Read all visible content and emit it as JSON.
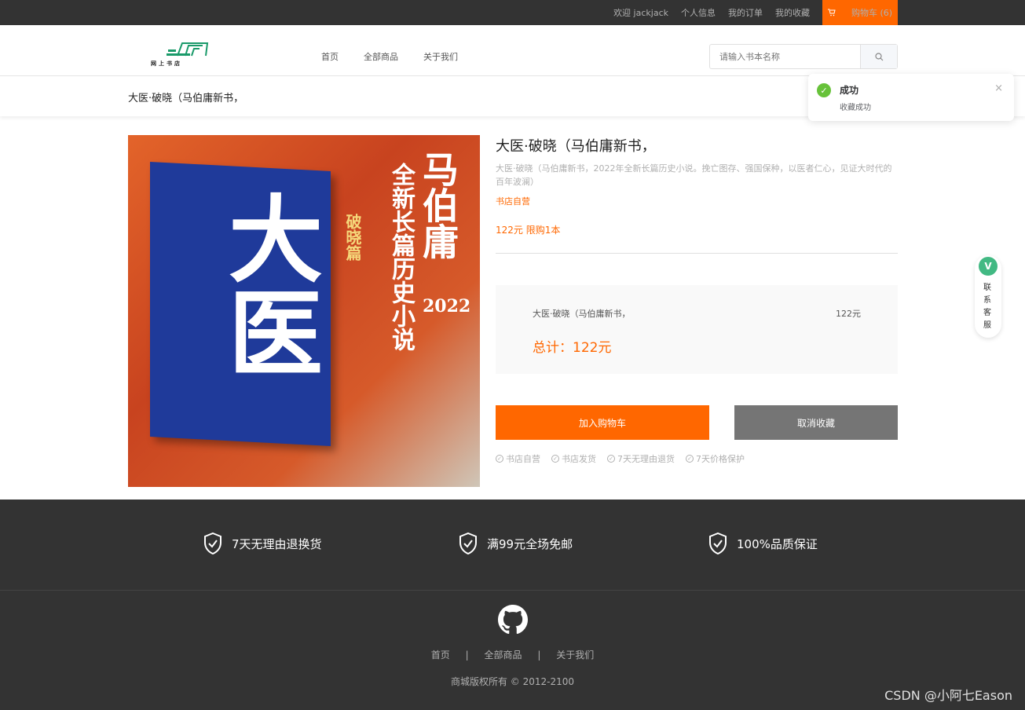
{
  "topbar": {
    "welcome": "欢迎 jackjack",
    "profile": "个人信息",
    "orders": "我的订单",
    "favorites": "我的收藏",
    "cart": "购物车 (6)"
  },
  "header": {
    "logo_text": "网上书店",
    "nav": [
      "首页",
      "全部商品",
      "关于我们"
    ],
    "search_placeholder": "请输入书本名称"
  },
  "breadcrumb_title": "大医·破晓（马伯庸新书，",
  "toast": {
    "title": "成功",
    "message": "收藏成功",
    "close": "×"
  },
  "cover": {
    "big_chars": "大医",
    "vertical_main": "马伯庸",
    "vertical_sub": "全新长篇历史小说",
    "year": "2022",
    "subtitle": "破晓篇"
  },
  "product": {
    "title": "大医·破晓（马伯庸新书，",
    "description": "大医·破晓（马伯庸新书，2022年全新长篇历史小说。挽亡图存、强国保种，以医者仁心，见证大时代的百年波澜）",
    "shop": "书店自营",
    "price_line": "122元 限购1本"
  },
  "summary": {
    "name": "大医·破晓（马伯庸新书，",
    "price": "122元",
    "total": "总计：122元"
  },
  "buttons": {
    "add_cart": "加入购物车",
    "cancel_fav": "取消收藏"
  },
  "features": [
    "书店自营",
    "书店发货",
    "7天无理由退货",
    "7天价格保护"
  ],
  "service": {
    "icon": "V",
    "label": "联系客服"
  },
  "guarantees": [
    "7天无理由退换货",
    "满99元全场免邮",
    "100%品质保证"
  ],
  "footer": {
    "links": [
      "首页",
      "全部商品",
      "关于我们"
    ],
    "separator": "|",
    "copyright": "商城版权所有 © 2012-2100"
  },
  "watermark": "CSDN @小阿七Eason",
  "colors": {
    "accent": "#ff6700",
    "topbar": "#333333",
    "success": "#67c23a",
    "cancel_button": "#757575"
  }
}
